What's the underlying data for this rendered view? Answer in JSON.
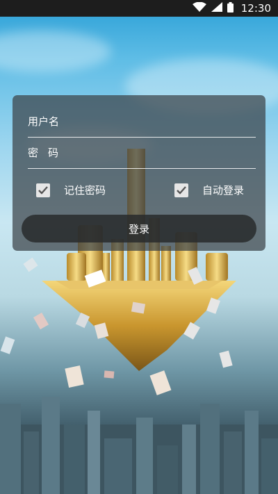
{
  "status_bar": {
    "time": "12:30",
    "icons": [
      "wifi-icon",
      "cellular-signal-icon",
      "battery-icon"
    ]
  },
  "login": {
    "username_placeholder": "用户名",
    "password_placeholder": "密码",
    "remember_password_label": "记住密码",
    "remember_password_checked": true,
    "auto_login_label": "自动登录",
    "auto_login_checked": true,
    "login_button_label": "登录"
  },
  "colors": {
    "panel_bg": "#3c4248",
    "button_bg": "#282a2c",
    "checkbox_bg": "#e6e6e6",
    "check_color": "#555555",
    "text": "#ffffff"
  }
}
